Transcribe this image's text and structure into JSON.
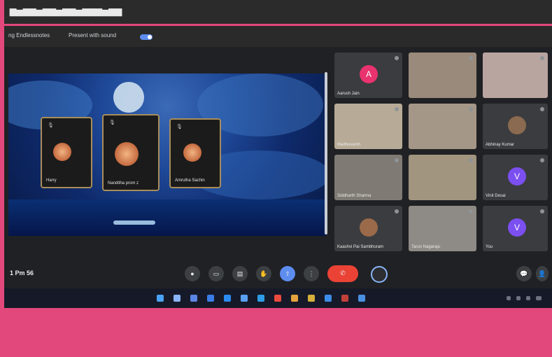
{
  "window": {
    "title": "▆▅▆▆▅▆▆▅▆▆▅▆▆▆▅▆▆"
  },
  "toolbar": {
    "items": [
      "ng Endlessnotes",
      "Present with sound"
    ]
  },
  "presentation": {
    "pips": [
      {
        "name": "Harry"
      },
      {
        "name": "Nanditha prom z"
      },
      {
        "name": "Amrutha Sachin"
      }
    ]
  },
  "participants": [
    {
      "name": "Aarush Jain",
      "letter": "A",
      "color": "#e8336e"
    },
    {
      "name": "",
      "letter": "",
      "color": ""
    },
    {
      "name": "",
      "letter": "",
      "color": ""
    },
    {
      "name": "Madhuvanth",
      "letter": "",
      "color": ""
    },
    {
      "name": "",
      "letter": "",
      "color": ""
    },
    {
      "name": "Abhinay Kumar",
      "letter": "",
      "color": ""
    },
    {
      "name": "Siddharth Sharma",
      "letter": "",
      "color": ""
    },
    {
      "name": "",
      "letter": "",
      "color": ""
    },
    {
      "name": "Vinit Desai",
      "letter": "V",
      "color": "#7b4ff0"
    },
    {
      "name": "Kaashvi Pai Sambhuram",
      "letter": "",
      "color": ""
    },
    {
      "name": "Tarun Nagaraju",
      "letter": "",
      "color": ""
    },
    {
      "name": "You",
      "letter": "V",
      "color": "#7b4ff0"
    }
  ],
  "controls": {
    "clock": "1 Pm 56",
    "buttons": [
      "mic",
      "camera",
      "captions",
      "raise hand",
      "share",
      "more"
    ],
    "end_call": "Leave call"
  },
  "accent_colors": {
    "pink": "#e2487c",
    "blue": "#5e8df0",
    "red": "#ea4335"
  }
}
